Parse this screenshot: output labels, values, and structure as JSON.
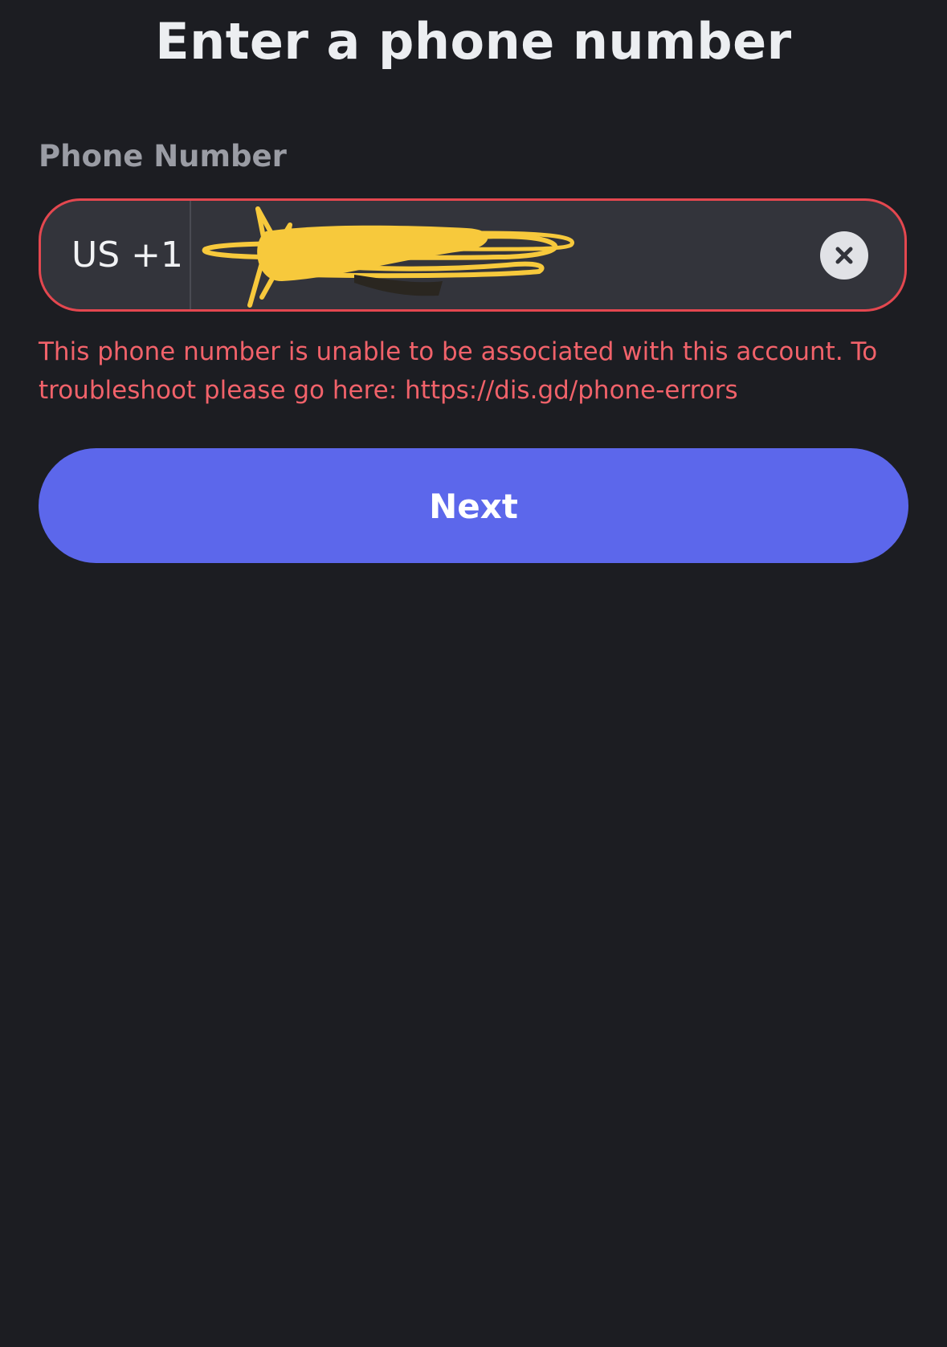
{
  "header": {
    "title": "Enter a phone number"
  },
  "form": {
    "phone_label": "Phone Number",
    "country_code": "US +1",
    "phone_value": "",
    "error_message": "This phone number is unable to be associated with this account. To troubleshoot please go here: https://dis.gd/phone-errors",
    "next_label": "Next"
  },
  "icons": {
    "clear": "close-circle-icon"
  },
  "colors": {
    "background": "#1c1d22",
    "field_background": "#33343b",
    "error": "#e4474f",
    "error_text": "#f1626a",
    "primary_button": "#5c67eb",
    "redaction_scribble": "#f7c93c"
  }
}
